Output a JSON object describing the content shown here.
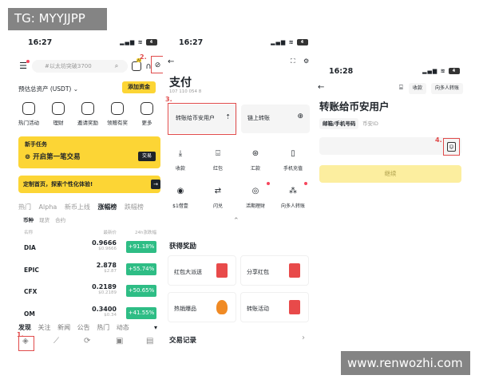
{
  "watermarks": {
    "top_left": "TG: MYYJJPP",
    "bottom_right": "www.renwozhi.com"
  },
  "screen1": {
    "time": "16:27",
    "battery": "4",
    "search_placeholder": "#以太坊突破3700",
    "badge_ai": "AI",
    "step2": "2.",
    "balance_label": "预估总资产 (USDT)",
    "add_funds": "添加资金",
    "quick": [
      "热门活动",
      "理财",
      "邀请奖励",
      "领赠有奖",
      "更多"
    ],
    "task_title": "新手任务",
    "task_text": "开启第一笔交易",
    "task_btn": "交易",
    "banner_text": "定制首页，探索个性化体验!",
    "market_tabs": [
      "热门",
      "Alpha",
      "新币上线",
      "涨幅榜",
      "跌幅榜"
    ],
    "active_market_tab": "涨幅榜",
    "sub_tabs": [
      "币种",
      "现货",
      "合约"
    ],
    "col_name": "名称",
    "col_price": "最新价",
    "col_change": "24h涨跌幅",
    "rows": [
      {
        "symbol": "DIA",
        "price": "0.9666",
        "sub": "$0.9666",
        "change": "+91.18%"
      },
      {
        "symbol": "EPIC",
        "price": "2.878",
        "sub": "$2.87",
        "change": "+55.74%"
      },
      {
        "symbol": "CFX",
        "price": "0.2189",
        "sub": "$0.2189",
        "change": "+50.65%"
      },
      {
        "symbol": "OM",
        "price": "0.3400",
        "sub": "$0.34",
        "change": "+41.55%"
      }
    ],
    "bottom_tabs": [
      "发现",
      "关注",
      "新闻",
      "公告",
      "热门",
      "动态"
    ],
    "step1": "1."
  },
  "screen2": {
    "time": "16:27",
    "battery": "4",
    "title": "支付",
    "pay_id": "107 110 054 8",
    "step3": "3.",
    "card1": "转账给币安用户",
    "card2": "链上转账",
    "grid": [
      "收款",
      "红包",
      "汇款",
      "手机充值",
      "$1借壹",
      "闪兑",
      "活期理财",
      "向多人转账"
    ],
    "rewards_title": "获得奖励",
    "rewards": [
      "红包大派送",
      "分享红包",
      "热销爆品",
      "转账活动"
    ],
    "records_title": "交易记录"
  },
  "screen3": {
    "time": "16:28",
    "battery": "4",
    "chip_receive": "收款",
    "chip_multi": "向多人转账",
    "title": "转账给币安用户",
    "tab_email": "邮箱/手机号码",
    "tab_id": "币安ID",
    "step4": "4.",
    "continue_btn": "继续"
  }
}
